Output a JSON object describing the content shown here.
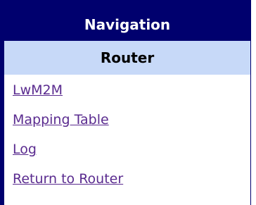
{
  "navigation": {
    "title": "Navigation",
    "section": "Router",
    "links": [
      {
        "label": "LwM2M "
      },
      {
        "label": "Mapping Table "
      },
      {
        "label": "Log "
      },
      {
        "label": "Return to Router "
      }
    ]
  },
  "colors": {
    "header_bg": "#00006e",
    "section_bg": "#c7d9f8",
    "link": "#5a2b8f"
  }
}
